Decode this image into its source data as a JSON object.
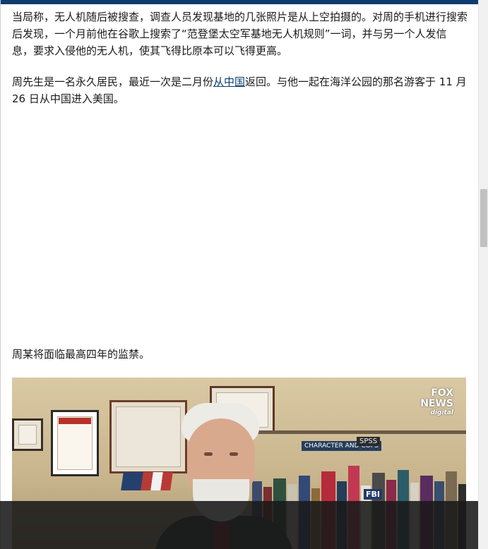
{
  "article": {
    "p1": "当局称，无人机随后被搜查，调查人员发现基地的几张照片是从上空拍摄的。对周的手机进行搜索后发现，一个月前他在谷歌上搜索了“范登堡太空军基地无人机规则”一词，并与另一个人发信息，要求入侵他的无人机，使其飞得比原本可以飞得更高。",
    "p2_before": "周先生是一名永久居民，最近一次是二月份",
    "p2_link": "从中国",
    "p2_after": "返回。与他一起在海洋公园的那名游客于 11 月 26 日从中国进入美国。",
    "p3": "周某将面临最高四年的监禁。"
  },
  "video": {
    "logo_line1": "FOX",
    "logo_line2": "NEWS",
    "logo_line3": "digital",
    "book_label": "CHARACTER AND COPS",
    "book_spss": "SPSS",
    "book_fbi": "FBI"
  },
  "colors": {
    "header_bar": "#0f3c6e",
    "link": "#0b3d73",
    "text": "#1a1a1a"
  }
}
